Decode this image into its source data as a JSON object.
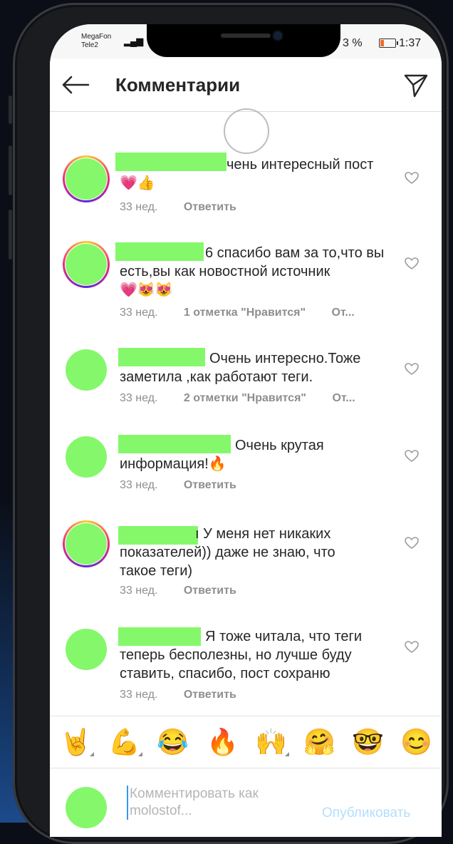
{
  "status": {
    "carrier1": "MegaFon",
    "carrier2": "Tele2",
    "battery": "3 %",
    "time": "1:37"
  },
  "header": {
    "title": "Комментарии"
  },
  "comments": [
    {
      "text": "чень интересный пост",
      "emoji": "💗👍",
      "time": "33 нед.",
      "action": "Ответить",
      "action2": ""
    },
    {
      "text": "6 спасибо вам за то,что вы есть,вы как новостной источник",
      "emoji": "💗😻😻",
      "time": "33 нед.",
      "action": "1 отметка \"Нравится\"",
      "action2": "От..."
    },
    {
      "text": "Очень интересно.Тоже заметила ,как работают теги.",
      "emoji": "",
      "time": "33 нед.",
      "action": "2 отметки \"Нравится\"",
      "action2": "От..."
    },
    {
      "text": "Очень крутая информация!🔥",
      "emoji": "",
      "time": "33 нед.",
      "action": "Ответить",
      "action2": ""
    },
    {
      "text": "ı У меня нет никаких показателей)) даже не знаю, что такое теги)",
      "emoji": "",
      "time": "33 нед.",
      "action": "Ответить",
      "action2": ""
    },
    {
      "text": "Я тоже читала, что теги теперь бесполезны, но лучше буду ставить, спасибо, пост сохраню",
      "emoji": "",
      "time": "33 нед.",
      "action": "Ответить",
      "action2": ""
    }
  ],
  "emoji_bar": [
    "🤘",
    "💪",
    "😂",
    "🔥",
    "🙌",
    "🤗",
    "🤓",
    "😊"
  ],
  "compose": {
    "placeholder": "Комментировать как molostof...",
    "publish": "Опубликовать"
  }
}
